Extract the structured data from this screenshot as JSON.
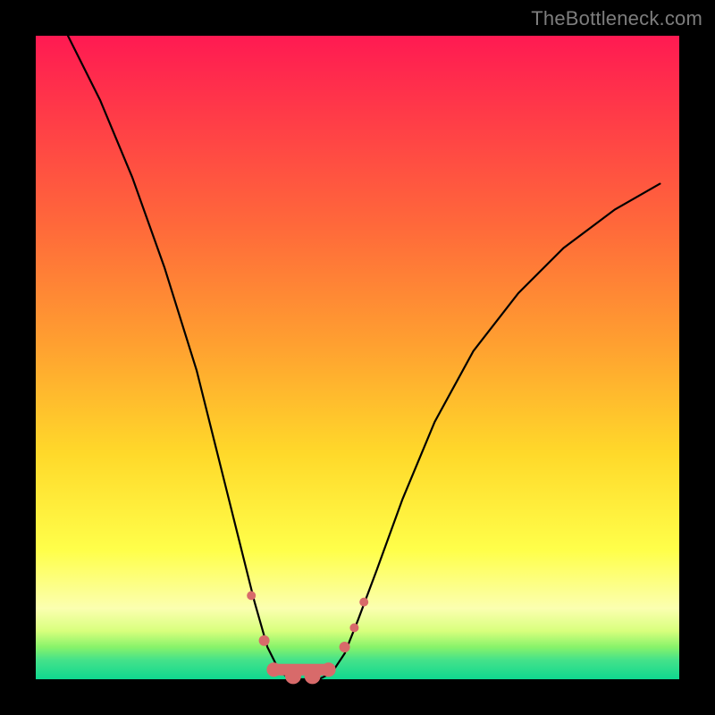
{
  "watermark": "TheBottleneck.com",
  "colors": {
    "curve_stroke": "#000000",
    "marker_fill": "#d86a6a",
    "marker_stroke": "#c15858"
  },
  "chart_data": {
    "type": "line",
    "title": "",
    "xlabel": "",
    "ylabel": "",
    "xlim": [
      0,
      100
    ],
    "ylim": [
      0,
      100
    ],
    "note": "x is horizontal position (% of plot width, left→right); y is bottleneck percentage (0 at bottom/green, 100 at top/red). Curve plunges from top-left to ~0 around x≈37–46 then rises toward upper-right.",
    "series": [
      {
        "name": "bottleneck-curve",
        "x": [
          5,
          10,
          15,
          20,
          25,
          28,
          31,
          34,
          36,
          38,
          40,
          42,
          44,
          46,
          48,
          50,
          53,
          57,
          62,
          68,
          75,
          82,
          90,
          97
        ],
        "y": [
          100,
          90,
          78,
          64,
          48,
          36,
          24,
          12,
          5,
          1,
          0,
          0,
          0,
          1,
          4,
          9,
          17,
          28,
          40,
          51,
          60,
          67,
          73,
          77
        ]
      }
    ],
    "markers": {
      "name": "highlighted-points",
      "points": [
        {
          "x": 33.5,
          "y": 13,
          "r": 5
        },
        {
          "x": 35.5,
          "y": 6,
          "r": 6
        },
        {
          "x": 37.0,
          "y": 1.5,
          "r": 8
        },
        {
          "x": 40.0,
          "y": 0.5,
          "r": 9
        },
        {
          "x": 43.0,
          "y": 0.5,
          "r": 9
        },
        {
          "x": 45.5,
          "y": 1.5,
          "r": 8
        },
        {
          "x": 48.0,
          "y": 5,
          "r": 6
        },
        {
          "x": 49.5,
          "y": 8,
          "r": 5
        },
        {
          "x": 51.0,
          "y": 12,
          "r": 5
        }
      ]
    }
  }
}
